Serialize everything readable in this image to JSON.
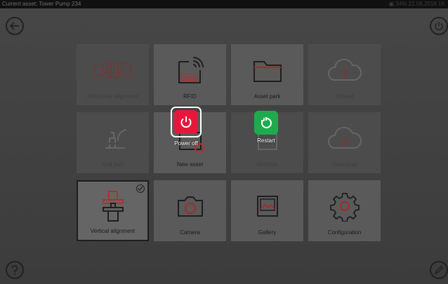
{
  "status_bar": {
    "current_asset": "Current asset: Tower Pump 234",
    "status_right": "▣ 34%  22.08.2018  16:"
  },
  "tiles": [
    {
      "label": "Horizontal alignment",
      "icon": "horizontal-alignment-icon",
      "state": "disabled"
    },
    {
      "label": "RFID",
      "icon": "rfid-icon",
      "state": "enabled",
      "icon_text": "RFID"
    },
    {
      "label": "Asset park",
      "icon": "folder-icon",
      "state": "enabled"
    },
    {
      "label": "Upload",
      "icon": "cloud-upload-icon",
      "state": "disabled"
    },
    {
      "label": "Soft foot",
      "icon": "soft-foot-icon",
      "state": "disabled"
    },
    {
      "label": "New asset",
      "icon": "new-asset-icon",
      "state": "enabled"
    },
    {
      "label": "Resume",
      "icon": "resume-icon",
      "state": "disabled"
    },
    {
      "label": "Download",
      "icon": "cloud-download-icon",
      "state": "disabled"
    },
    {
      "label": "Vertical alignment",
      "icon": "vertical-alignment-icon",
      "state": "selected"
    },
    {
      "label": "Camera",
      "icon": "camera-icon",
      "state": "enabled"
    },
    {
      "label": "Gallery",
      "icon": "gallery-icon",
      "state": "enabled"
    },
    {
      "label": "Configuration",
      "icon": "gear-icon",
      "state": "enabled"
    }
  ],
  "power_popup": {
    "power_off_label": "Power off",
    "restart_label": "Restart",
    "colors": {
      "power_off": "#e5183c",
      "restart": "#1eab4d"
    }
  },
  "nav_icons": [
    "back-arrow-icon",
    "power-icon",
    "help-icon",
    "edit-pen-icon"
  ]
}
